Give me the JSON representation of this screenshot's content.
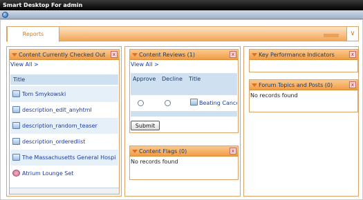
{
  "window": {
    "title": "Smart Desktop For admin"
  },
  "tabs": [
    {
      "label": "Reports"
    }
  ],
  "checked_out": {
    "title": "Content Currently Checked Out",
    "view_all": "View All >",
    "column": "Title",
    "items": [
      {
        "label": "Tom Smykowski"
      },
      {
        "label": "description_edit_anyhtml"
      },
      {
        "label": "description_random_teaser"
      },
      {
        "label": "description_orderedlist"
      },
      {
        "label": "The Massachusetts General Hospi"
      },
      {
        "label": "Atrium Lounge Set"
      }
    ]
  },
  "reviews": {
    "title": "Content Reviews (1)",
    "view_all": "View All >",
    "columns": {
      "approve": "Approve",
      "decline": "Decline",
      "title": "Title"
    },
    "row": {
      "title": "Beating Cance"
    },
    "submit": "Submit"
  },
  "flags": {
    "title": "Content Flags (0)",
    "empty": "No records found"
  },
  "kpi": {
    "title": "Key Performance Indicators"
  },
  "forum": {
    "title": "Forum Topics and Posts (0)",
    "empty": "No records found"
  },
  "icons": {
    "toolbar": "globe-icon",
    "collapse": "triangle-down-icon",
    "close": "close-icon",
    "row": "document-icon"
  }
}
